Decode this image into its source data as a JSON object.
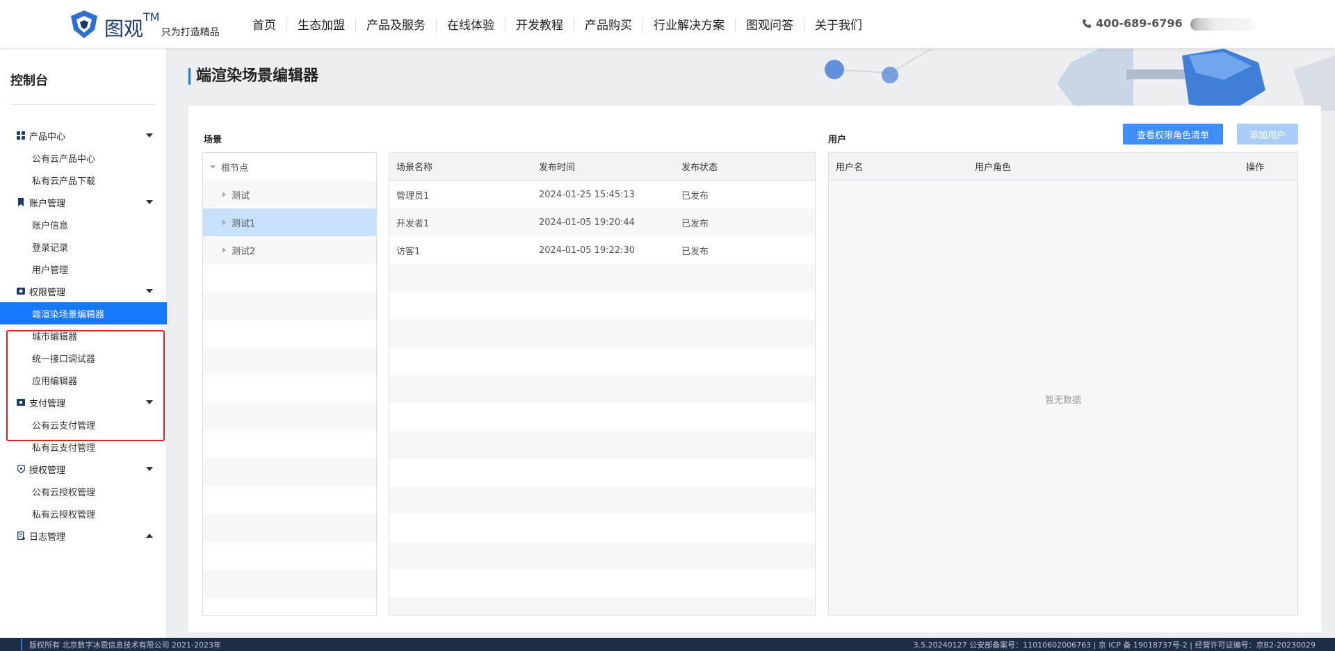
{
  "header": {
    "logo_text": "图观",
    "logo_tm": "TM",
    "logo_slogan": "只为打造精品",
    "nav": [
      "首页",
      "生态加盟",
      "产品及服务",
      "在线体验",
      "开发教程",
      "产品购买",
      "行业解决方案",
      "图观问答",
      "关于我们"
    ],
    "phone": "400-689-6796"
  },
  "sidebar": {
    "title": "控制台",
    "groups": [
      {
        "label": "产品中心",
        "icon": "grid-icon",
        "items": [
          "公有云产品中心",
          "私有云产品下载"
        ]
      },
      {
        "label": "账户管理",
        "icon": "bookmark-icon",
        "items": [
          "账户信息",
          "登录记录",
          "用户管理"
        ]
      },
      {
        "label": "权限管理",
        "icon": "camera-icon",
        "items": [
          "端渲染场景编辑器",
          "城市编辑器",
          "统一接口调试器",
          "应用编辑器"
        ]
      },
      {
        "label": "支付管理",
        "icon": "ticket-icon",
        "items": [
          "公有云支付管理",
          "私有云支付管理"
        ]
      },
      {
        "label": "授权管理",
        "icon": "shield-icon",
        "items": [
          "公有云授权管理",
          "私有云授权管理"
        ]
      },
      {
        "label": "日志管理",
        "icon": "log-icon",
        "items": []
      }
    ]
  },
  "main": {
    "title": "端渲染场景编辑器",
    "scene_label": "场景",
    "user_label": "用户",
    "btn_view_roles": "查看权限角色清单",
    "btn_add_user": "添加用户",
    "tree": {
      "root": "根节点",
      "children": [
        "测试",
        "测试1",
        "测试2"
      ],
      "selected": "测试1"
    },
    "scene_table": {
      "columns": [
        "场景名称",
        "发布时间",
        "发布状态"
      ],
      "rows": [
        [
          "管理员1",
          "2024-01-25 15:45:13",
          "已发布"
        ],
        [
          "开发者1",
          "2024-01-05 19:20:44",
          "已发布"
        ],
        [
          "访客1",
          "2024-01-05 19:22:30",
          "已发布"
        ]
      ]
    },
    "user_table": {
      "columns": [
        "用户名",
        "用户角色",
        "操作"
      ],
      "empty_text": "暂无数据"
    }
  },
  "footer": {
    "copyright": "版权所有 北京数字冰雹信息技术有限公司 2021-2023年",
    "right": "3.5.20240127 公安部备案号：11010602006763 | 京 ICP 备 19018737号-2 | 经营许可证编号：京B2-20230029"
  },
  "colors": {
    "accent": "#1677ff",
    "button_primary": "#3d8ef7",
    "button_disabled": "#a9cdf8",
    "highlight_box": "#e02020",
    "tree_selected": "#c7e0fb"
  }
}
